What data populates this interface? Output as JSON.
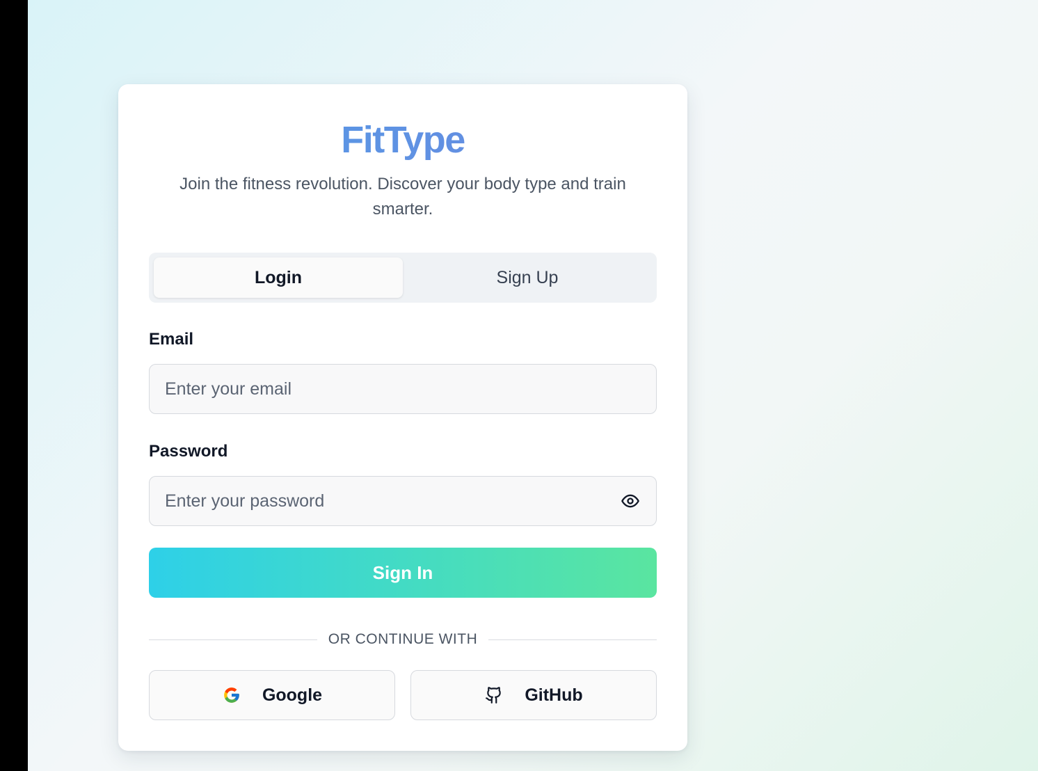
{
  "brand": {
    "name": "FitType"
  },
  "tagline": "Join the fitness revolution. Discover your body type and train smarter.",
  "tabs": [
    {
      "label": "Login",
      "active": true
    },
    {
      "label": "Sign Up",
      "active": false
    }
  ],
  "form": {
    "email": {
      "label": "Email",
      "placeholder": "Enter your email",
      "value": ""
    },
    "password": {
      "label": "Password",
      "placeholder": "Enter your password",
      "value": ""
    },
    "submit_label": "Sign In"
  },
  "divider_text": "OR CONTINUE WITH",
  "social": [
    {
      "label": "Google",
      "icon": "google-icon"
    },
    {
      "label": "GitHub",
      "icon": "github-icon"
    }
  ],
  "colors": {
    "brand_gradient_start": "#4f9ee6",
    "brand_gradient_end": "#6f86e0",
    "button_gradient_start": "#2ed0e8",
    "button_gradient_end": "#5ae5a0"
  }
}
